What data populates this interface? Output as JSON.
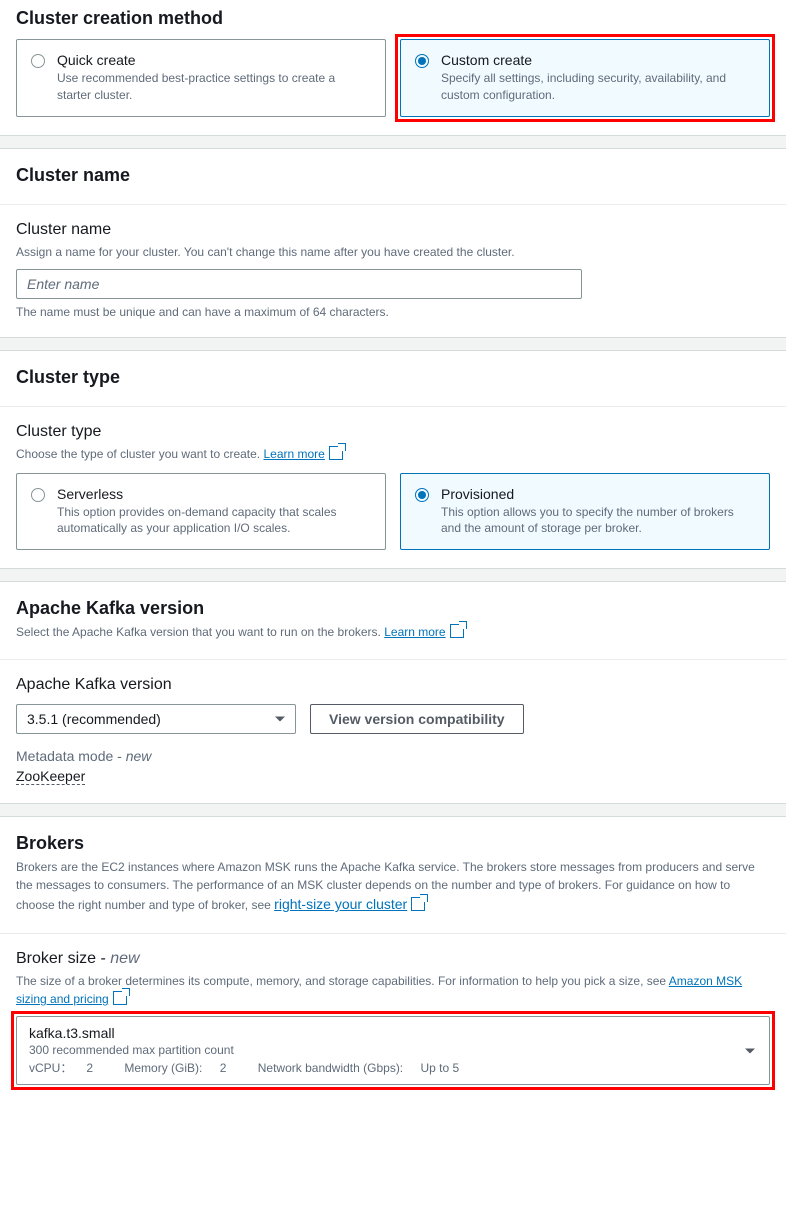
{
  "creationMethod": {
    "title": "Cluster creation method",
    "quick": {
      "label": "Quick create",
      "desc": "Use recommended best-practice settings to create a starter cluster."
    },
    "custom": {
      "label": "Custom create",
      "desc": "Specify all settings, including security, availability, and custom configuration."
    }
  },
  "clusterName": {
    "title": "Cluster name",
    "fieldLabel": "Cluster name",
    "helper": "Assign a name for your cluster. You can't change this name after you have created the cluster.",
    "placeholder": "Enter name",
    "belowHelper": "The name must be unique and can have a maximum of 64 characters."
  },
  "clusterType": {
    "title": "Cluster type",
    "fieldLabel": "Cluster type",
    "helper": "Choose the type of cluster you want to create. ",
    "learnMore": "Learn more",
    "serverless": {
      "label": "Serverless",
      "desc": "This option provides on-demand capacity that scales automatically as your application I/O scales."
    },
    "provisioned": {
      "label": "Provisioned",
      "desc": "This option allows you to specify the number of brokers and the amount of storage per broker."
    }
  },
  "kafkaVersion": {
    "title": "Apache Kafka version",
    "helper": "Select the Apache Kafka version that you want to run on the brokers. ",
    "learnMore": "Learn more",
    "fieldLabel": "Apache Kafka version",
    "selected": "3.5.1 (recommended)",
    "viewCompat": "View version compatibility",
    "metaLabel": "Metadata mode - ",
    "metaNew": "new",
    "metaValue": "ZooKeeper"
  },
  "brokers": {
    "title": "Brokers",
    "helper": "Brokers are the EC2 instances where Amazon MSK runs the Apache Kafka service. The brokers store messages from producers and serve the messages to consumers. The performance of an MSK cluster depends on the number and type of brokers. For guidance on how to choose the right number and type of broker, see ",
    "rightSizeLink": "right-size your cluster",
    "sizeLabel": "Broker size - ",
    "sizeNew": "new",
    "sizeHelper": "The size of a broker determines its compute, memory, and storage capabilities. For information to help you pick a size, see ",
    "pricingLink": "Amazon MSK sizing and pricing",
    "selected": {
      "name": "kafka.t3.small",
      "partition": "300 recommended max partition count",
      "vcpuLabel": "vCPU：",
      "vcpu": "2",
      "memLabel": "Memory (GiB): ",
      "mem": "2",
      "netLabel": "Network bandwidth (Gbps): ",
      "net": "Up to 5"
    }
  }
}
